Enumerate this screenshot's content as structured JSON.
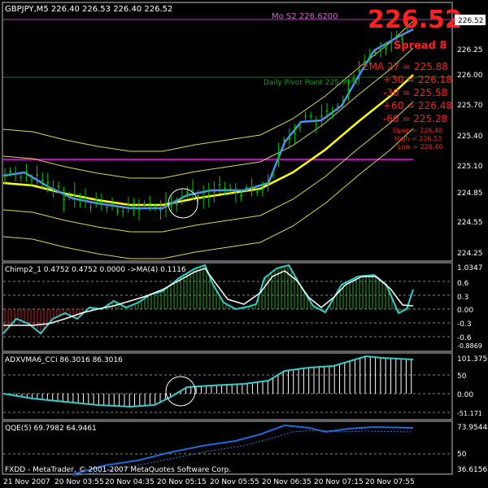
{
  "main": {
    "header": "GBPJPY,M5  226.40 226.53 226.40 226.52",
    "big_price": "226.52",
    "spread": "Spread 8",
    "mo_s2": "Mo S2  226.6200",
    "daily_pivot": "Daily Pivot Point  225.9950",
    "ema_lines": [
      "EMA 27 = 225.88",
      "+30 = 226.18",
      "-30 = 225.58",
      "+60 = 226.48",
      "-60 = 225.28"
    ],
    "ohlc": [
      "Open = 226.40",
      "High = 226.53",
      "Low = 226.40"
    ],
    "price_axis": [
      "226.52",
      "226.25",
      "226.00",
      "225.70",
      "225.40",
      "225.10",
      "224.85",
      "224.55",
      "224.25"
    ],
    "current_price": "226.52",
    "colors": {
      "ema": "#4f8fff",
      "yellow": "#ffff00",
      "channel": "#d8d850",
      "candle": "#00cc00",
      "pivot": "#cc00cc",
      "red": "#ff2020"
    }
  },
  "chimp": {
    "header": "Chimp2_1 0.4752 0.4752 0.0000  ->MA(4) 0.1116",
    "axis": [
      "1.0347",
      "0.6",
      "0.3",
      "0.00",
      "-0.3",
      "-0.6",
      "-0.8869"
    ]
  },
  "adx": {
    "header": "ADXVMA6_CCi 86.3016 86.3016",
    "axis": [
      "101.3759",
      "50",
      "0.00",
      "-51.171"
    ]
  },
  "qqe": {
    "header": "QQE(5) 69.7982 64.9461",
    "axis": [
      "73.9544",
      "50",
      "36.6156"
    ],
    "watermark": "FXDD - MetaTrader, © 2001-2007 MetaQuotes Software Corp."
  },
  "time_axis": [
    "21 Nov 2007",
    "20 Nov 03:55",
    "20 Nov 04:35",
    "20 Nov 05:15",
    "20 Nov 05:55",
    "20 Nov 06:35",
    "20 Nov 07:15",
    "20 Nov 07:55"
  ]
}
